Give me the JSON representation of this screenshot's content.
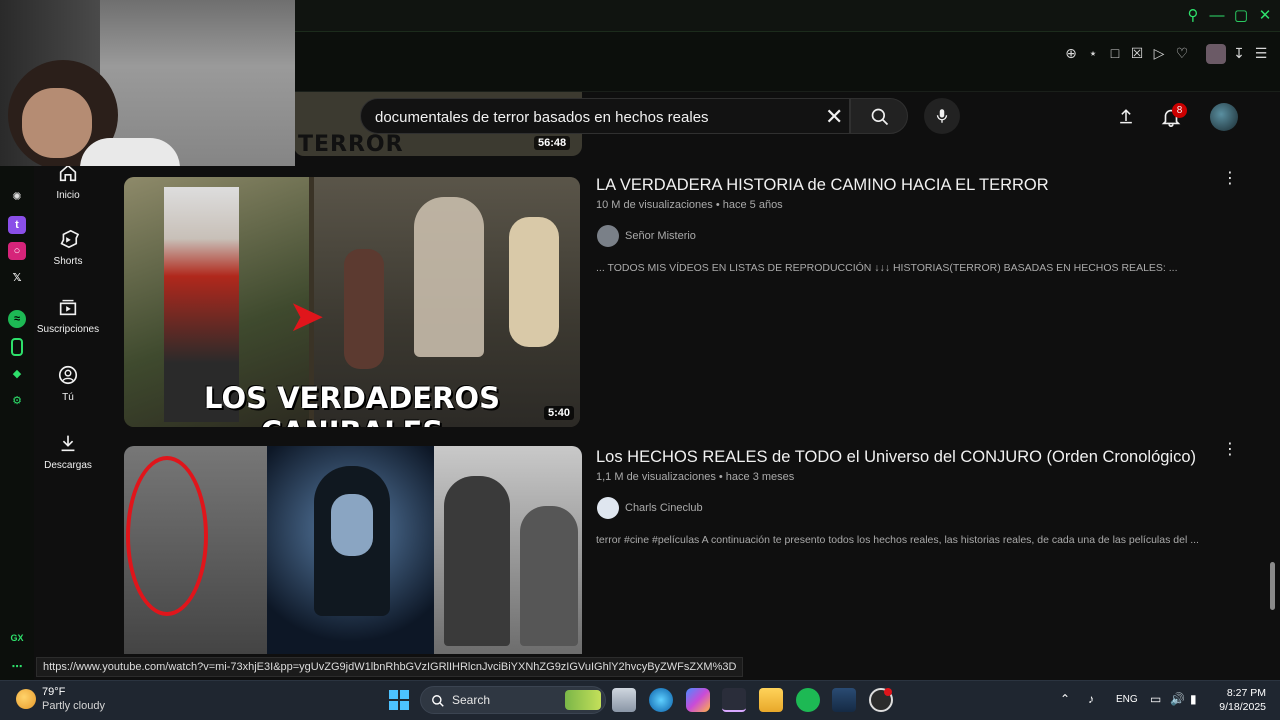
{
  "browser": {
    "toolbar_icons": [
      "zoom-icon",
      "pin-icon",
      "snapshot-icon",
      "shield-icon",
      "play-icon",
      "heart-icon",
      "avatar",
      "download-icon",
      "menu-icon"
    ]
  },
  "youtube": {
    "search": {
      "value": "documentales de terror basados en hechos reales"
    },
    "notifications_badge": "8",
    "partial_thumb_label": "TERROR",
    "partial_duration": "56:48",
    "sidebar": [
      {
        "label": "Inicio",
        "icon": "home-icon"
      },
      {
        "label": "Shorts",
        "icon": "shorts-icon"
      },
      {
        "label": "Suscripciones",
        "icon": "subscriptions-icon"
      },
      {
        "label": "Tú",
        "icon": "you-icon"
      },
      {
        "label": "Descargas",
        "icon": "download-icon"
      }
    ],
    "results": [
      {
        "title": "LA VERDADERA HISTORIA de CAMINO HACIA EL TERROR",
        "meta": "10 M de visualizaciones • hace 5 años",
        "channel": "Señor Misterio",
        "description": "... TODOS MIS VÍDEOS EN LISTAS DE REPRODUCCIÓN ↓↓↓ HISTORIAS(TERROR) BASADAS EN HECHOS REALES: ...",
        "thumb_text": "LOS VERDADEROS CANIBALES",
        "duration": "5:40"
      },
      {
        "title": "Los HECHOS REALES de TODO el Universo del CONJURO (Orden Cronológico)",
        "meta": "1,1 M de visualizaciones • hace 3 meses",
        "channel": "Charls Cineclub",
        "description": "terror #cine #películas A continuación te presento todos los hechos reales, las historias reales, de cada una de las películas del ..."
      }
    ]
  },
  "status_url": "https://www.youtube.com/watch?v=mi-73xhjE3I&pp=ygUvZG9jdW1lbnRhbGVzIGRlIHRlcnJvciBiYXNhZG9zIGVuIGhlY2hvcyByZWFsZXM%3D",
  "gx_label": "GX",
  "taskbar": {
    "weather_temp": "79°F",
    "weather_desc": "Partly cloudy",
    "search_label": "Search",
    "lang": "ENG",
    "time": "8:27 PM",
    "date": "9/18/2025"
  },
  "colors": {
    "accent": "#2ee06b",
    "badge": "#cc0000"
  }
}
